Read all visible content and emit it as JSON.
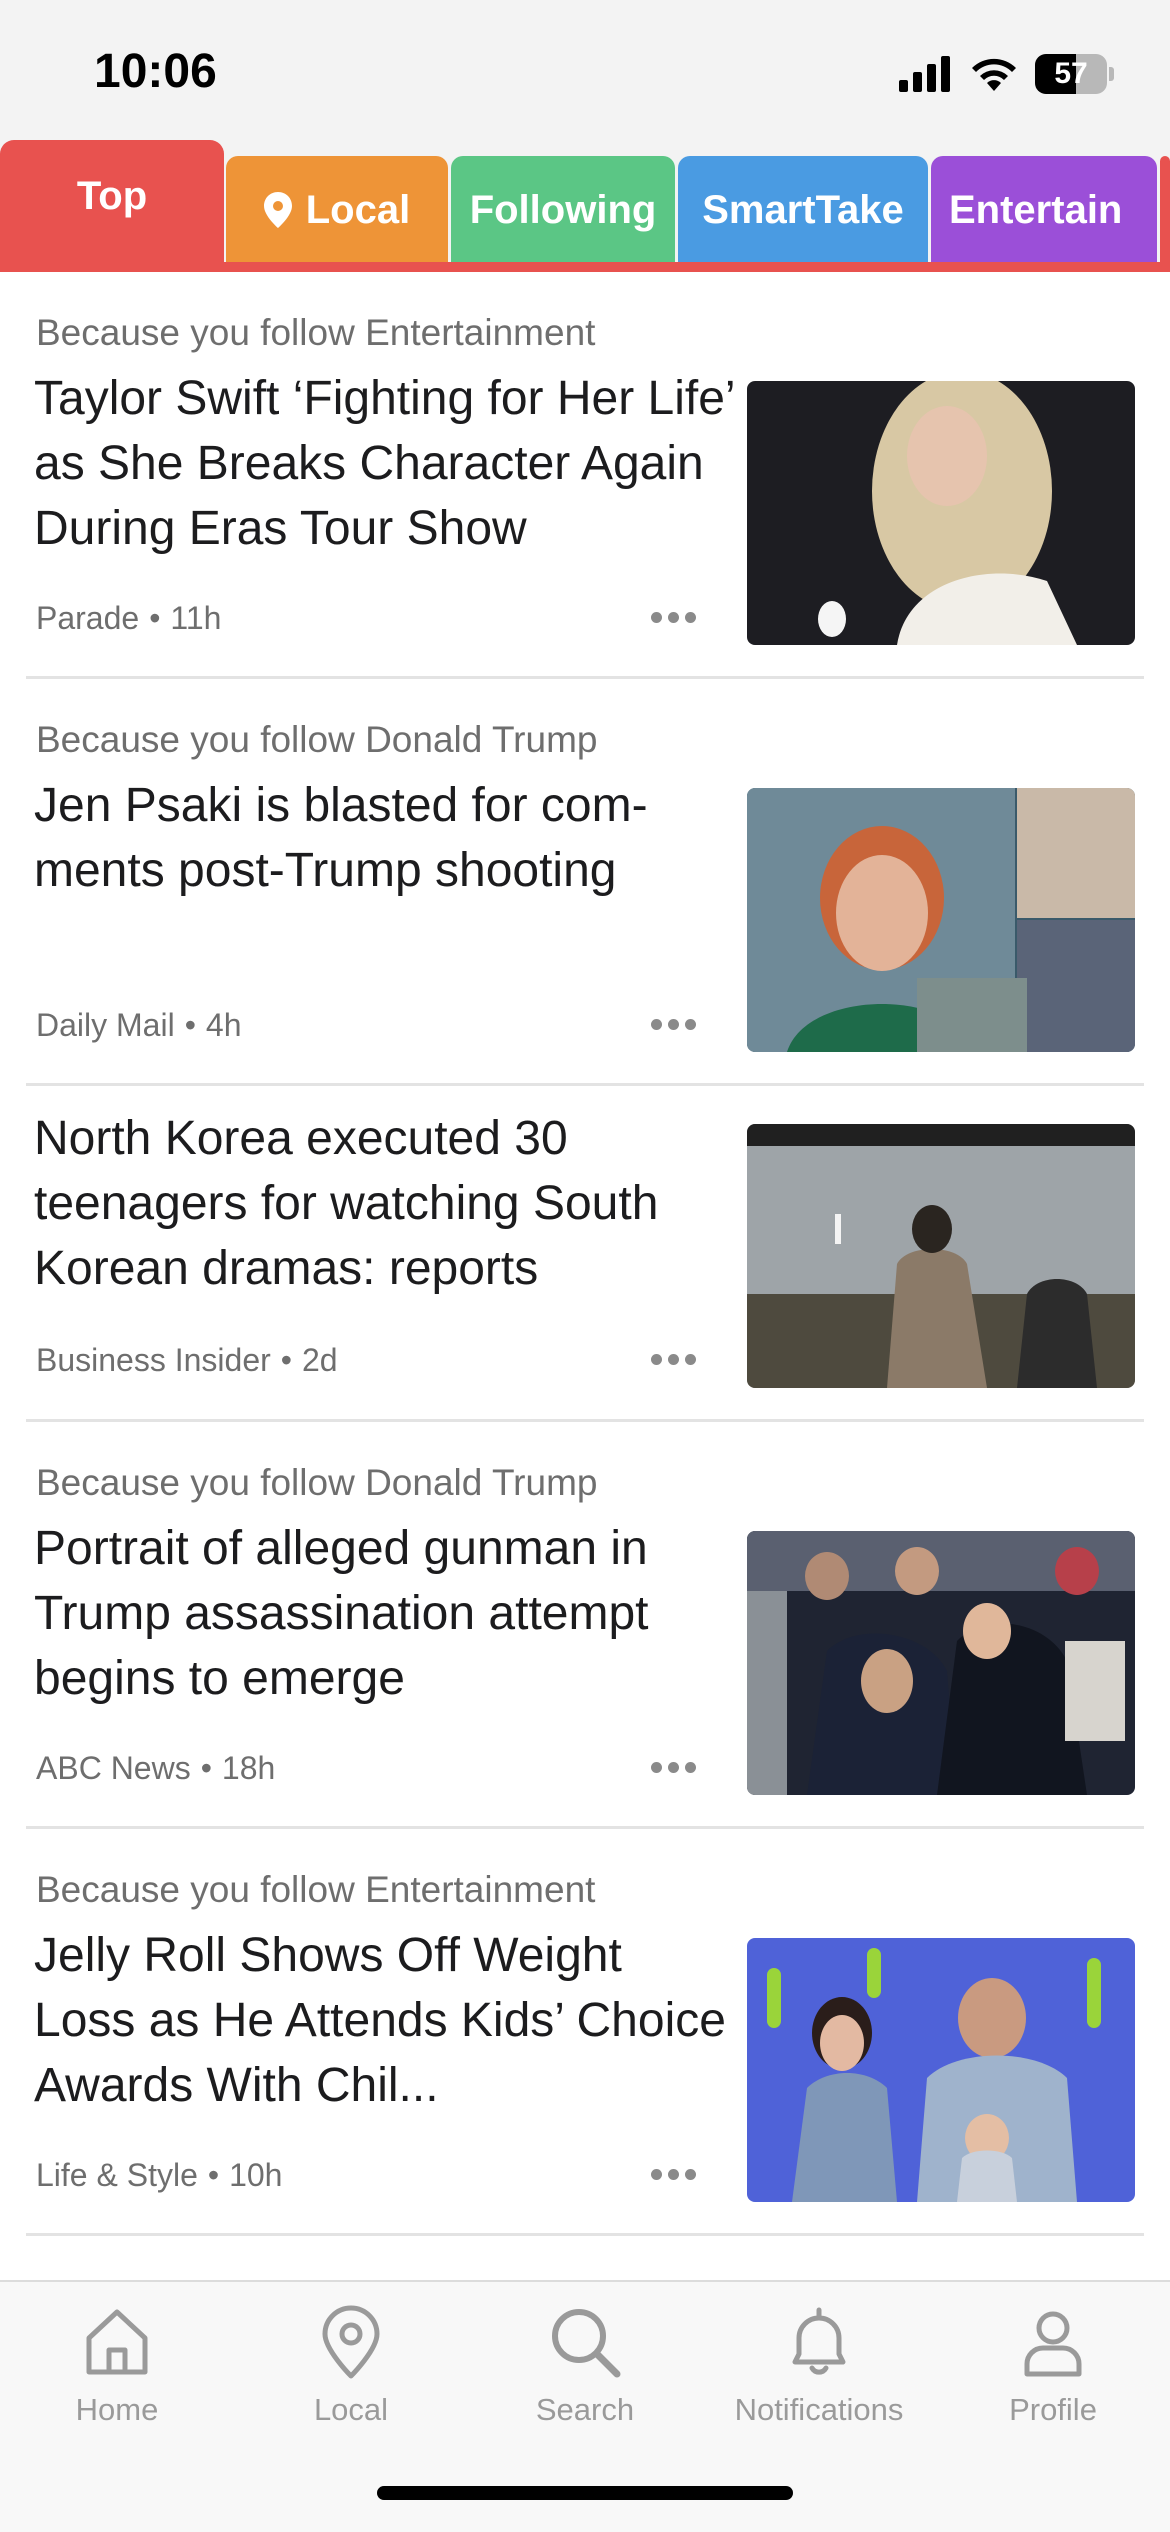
{
  "status_bar": {
    "time": "10:06",
    "battery_level": "57",
    "battery_fraction": 0.57
  },
  "tabs": [
    {
      "label": "Top",
      "color": "#e8524f",
      "active": true
    },
    {
      "label": "Local",
      "color": "#ee9437",
      "icon": "location-pin-icon"
    },
    {
      "label": "Following",
      "color": "#5bc685"
    },
    {
      "label": "SmartTake",
      "color": "#4a9be2"
    },
    {
      "label": "Entertain",
      "color": "#9b4fd8"
    }
  ],
  "articles": [
    {
      "reason": "Because you follow Entertainment",
      "headline": "Taylor Swift ‘Fighting for Her Life’ as She Breaks Character Again During Eras Tour Show",
      "source": "Parade",
      "age": "11h"
    },
    {
      "reason": "Because you follow Donald Trump",
      "headline": "Jen Psaki is blasted for com-ments post-Trump shooting",
      "source": "Daily Mail",
      "age": "4h"
    },
    {
      "reason": "",
      "headline": "North Korea executed 30 teenagers for watching South Korean dramas: reports",
      "source": "Business Insider",
      "age": "2d"
    },
    {
      "reason": "Because you follow Donald Trump",
      "headline": "Portrait of alleged gunman in Trump assassination attempt begins to emerge",
      "source": "ABC News",
      "age": "18h"
    },
    {
      "reason": "Because you follow Entertainment",
      "headline": "Jelly Roll Shows Off Weight Loss as He Attends Kids’ Choice Awards With Chil...",
      "source": "Life & Style",
      "age": "10h"
    }
  ],
  "bottom_nav": [
    {
      "label": "Home",
      "icon": "home-icon"
    },
    {
      "label": "Local",
      "icon": "location-pin-icon"
    },
    {
      "label": "Search",
      "icon": "search-icon"
    },
    {
      "label": "Notifications",
      "icon": "bell-icon"
    },
    {
      "label": "Profile",
      "icon": "person-icon"
    }
  ]
}
